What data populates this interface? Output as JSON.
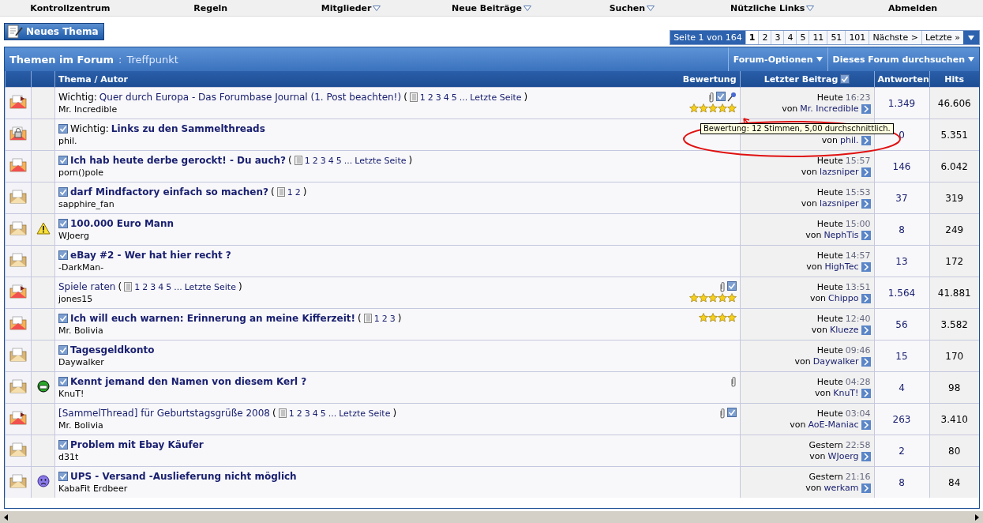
{
  "nav": [
    {
      "label": "Kontrollzentrum",
      "menu": false
    },
    {
      "label": "Regeln",
      "menu": false
    },
    {
      "label": "Mitglieder",
      "menu": true
    },
    {
      "label": "Neue Beiträge",
      "menu": true
    },
    {
      "label": "Suchen",
      "menu": true
    },
    {
      "label": "Nützliche Links",
      "menu": true
    },
    {
      "label": "Abmelden",
      "menu": false
    }
  ],
  "new_thread_button": "Neues Thema",
  "pagination": {
    "label": "Seite 1 von 164",
    "pages": [
      {
        "label": "1",
        "selected": true
      },
      {
        "label": "2",
        "selected": false
      },
      {
        "label": "3",
        "selected": false
      },
      {
        "label": "4",
        "selected": false
      },
      {
        "label": "5",
        "selected": false
      },
      {
        "label": "11",
        "selected": false
      },
      {
        "label": "51",
        "selected": false
      },
      {
        "label": "101",
        "selected": false
      }
    ],
    "next": "Nächste >",
    "last": "Letzte »"
  },
  "forum_header": {
    "title": "Themen im Forum",
    "separator": ":",
    "forum": "Treffpunkt",
    "buttons": [
      "Forum-Optionen",
      "Dieses Forum durchsuchen"
    ]
  },
  "columns": {
    "thread": "Thema / Autor",
    "rating": "Bewertung",
    "last_post": "Letzter Beitrag",
    "replies": "Antworten",
    "hits": "Hits"
  },
  "rows": [
    {
      "kind": "hot",
      "prefix": "Wichtig:",
      "title": "Quer durch Europa - Das Forumbase Journal (1. Post beachten!)",
      "subscribed": false,
      "unread": false,
      "paren_open": "(",
      "pages": [
        "1",
        "2",
        "3",
        "4",
        "5"
      ],
      "ellipsis": "...",
      "last_page": "Letzte Seite",
      "paren_close": ")",
      "author": "Mr. Incredible",
      "flags": [
        {
          "kind": "attachment"
        },
        {
          "kind": "checked"
        },
        {
          "kind": "pin"
        }
      ],
      "stars": 5,
      "last_post": {
        "day": "Heute",
        "time": "16:23",
        "by_label": "von",
        "by": "Mr. Incredible"
      },
      "replies": "1.349",
      "hits": "46.606"
    },
    {
      "kind": "locked",
      "prefix": "Wichtig:",
      "title": "Links zu den Sammelthreads",
      "subscribed": true,
      "unread": true,
      "author": "phil.",
      "last_post": {
        "by_label": "von",
        "by": "phil."
      },
      "replies": "0",
      "hits": "5.351"
    },
    {
      "kind": "new",
      "title": "Ich hab heute derbe gerockt! - Du auch?",
      "subscribed": true,
      "unread": true,
      "paren_open": "(",
      "pages": [
        "1",
        "2",
        "3",
        "4",
        "5"
      ],
      "ellipsis": "...",
      "last_page": "Letzte Seite",
      "paren_close": ")",
      "author": "porn()pole",
      "last_post": {
        "day": "Heute",
        "time": "15:57",
        "by_label": "von",
        "by": "lazsniper"
      },
      "replies": "146",
      "hits": "6.042"
    },
    {
      "kind": "read",
      "title": "darf Mindfactory einfach so machen?",
      "subscribed": true,
      "unread": true,
      "paren_open": "(",
      "pages": [
        "1",
        "2"
      ],
      "paren_close": ")",
      "author": "sapphire_fan",
      "last_post": {
        "day": "Heute",
        "time": "15:53",
        "by_label": "von",
        "by": "lazsniper"
      },
      "replies": "37",
      "hits": "319"
    },
    {
      "kind": "read",
      "post_icon": {
        "kind": "warning"
      },
      "title": "100.000 Euro Mann",
      "subscribed": true,
      "unread": true,
      "author": "WJoerg",
      "last_post": {
        "day": "Heute",
        "time": "15:00",
        "by_label": "von",
        "by": "NephTis"
      },
      "replies": "8",
      "hits": "249"
    },
    {
      "kind": "read",
      "title": "eBay #2 - Wer hat hier recht ?",
      "subscribed": true,
      "unread": true,
      "author": "-DarkMan-",
      "last_post": {
        "day": "Heute",
        "time": "14:57",
        "by_label": "von",
        "by": "HighTec"
      },
      "replies": "13",
      "hits": "172"
    },
    {
      "kind": "hot",
      "title": "Spiele raten",
      "subscribed": false,
      "unread": false,
      "paren_open": "(",
      "pages": [
        "1",
        "2",
        "3",
        "4",
        "5"
      ],
      "ellipsis": "...",
      "last_page": "Letzte Seite",
      "paren_close": ")",
      "author": "jones15",
      "flags": [
        {
          "kind": "attachment"
        },
        {
          "kind": "checked"
        }
      ],
      "stars": 5,
      "last_post": {
        "day": "Heute",
        "time": "13:51",
        "by_label": "von",
        "by": "Chippo"
      },
      "replies": "1.564",
      "hits": "41.881"
    },
    {
      "kind": "new",
      "title": "Ich will euch warnen: Erinnerung an meine Kifferzeit!",
      "subscribed": true,
      "unread": true,
      "paren_open": "(",
      "pages": [
        "1",
        "2",
        "3"
      ],
      "paren_close": ")",
      "author": "Mr. Bolivia",
      "stars": 4,
      "last_post": {
        "day": "Heute",
        "time": "12:40",
        "by_label": "von",
        "by": "Klueze"
      },
      "replies": "56",
      "hits": "3.582"
    },
    {
      "kind": "read",
      "title": "Tagesgeldkonto",
      "subscribed": true,
      "unread": true,
      "author": "Daywalker",
      "last_post": {
        "day": "Heute",
        "time": "09:46",
        "by_label": "von",
        "by": "Daywalker"
      },
      "replies": "15",
      "hits": "170"
    },
    {
      "kind": "read",
      "post_icon": {
        "kind": "grin"
      },
      "title": "Kennt jemand den Namen von diesem Kerl ?",
      "subscribed": true,
      "unread": true,
      "author": "KnuT!",
      "flags": [
        {
          "kind": "attachment"
        }
      ],
      "last_post": {
        "day": "Heute",
        "time": "04:28",
        "by_label": "von",
        "by": "KnuT!"
      },
      "replies": "4",
      "hits": "98"
    },
    {
      "kind": "hot",
      "title": "[SammelThread] für Geburtstagsgrüße 2008",
      "subscribed": false,
      "unread": false,
      "paren_open": "(",
      "pages": [
        "1",
        "2",
        "3",
        "4",
        "5"
      ],
      "ellipsis": "...",
      "last_page": "Letzte Seite",
      "paren_close": ")",
      "author": "Mr. Bolivia",
      "flags": [
        {
          "kind": "attachment"
        },
        {
          "kind": "checked"
        }
      ],
      "last_post": {
        "day": "Heute",
        "time": "03:04",
        "by_label": "von",
        "by": "AoE-Maniac"
      },
      "replies": "263",
      "hits": "3.410"
    },
    {
      "kind": "read",
      "title": "Problem mit Ebay Käufer",
      "subscribed": true,
      "unread": true,
      "author": "d31t",
      "last_post": {
        "day": "Gestern",
        "time": "22:58",
        "by_label": "von",
        "by": "WJoerg"
      },
      "replies": "2",
      "hits": "80"
    },
    {
      "kind": "read",
      "post_icon": {
        "kind": "sad"
      },
      "title": "UPS - Versand -Auslieferung nicht möglich",
      "subscribed": true,
      "unread": true,
      "author": "KabaFit Erdbeer",
      "last_post": {
        "day": "Gestern",
        "time": "21:16",
        "by_label": "von",
        "by": "werkam"
      },
      "replies": "8",
      "hits": "84"
    }
  ],
  "tooltip": "Bewertung: 12 Stimmen, 5,00 durchschnittlich."
}
